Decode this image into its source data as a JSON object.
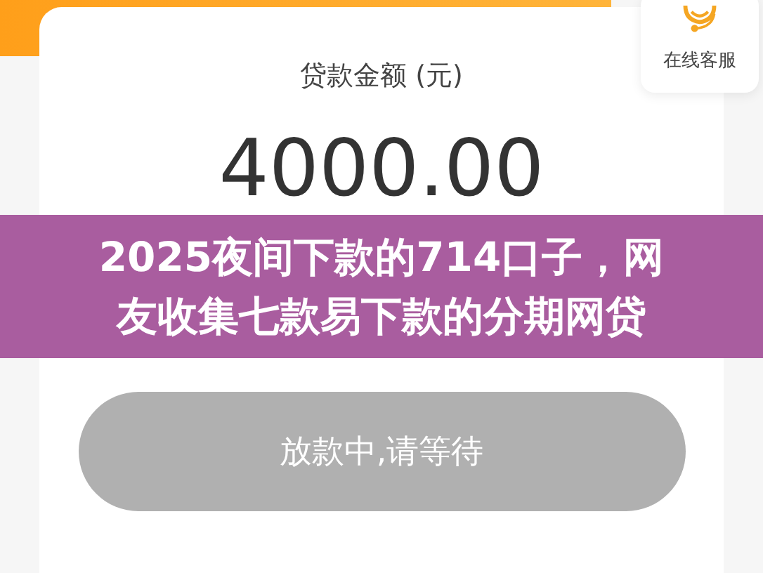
{
  "service": {
    "label": "在线客服"
  },
  "loan": {
    "label": "贷款金额 (元)",
    "amount": "4000.00"
  },
  "submit": {
    "label": "放款中,请等待",
    "disabled": true
  },
  "banner": {
    "lines": [
      "2025夜间下款的714口子，网",
      "友收集七款易下款的分期网贷"
    ]
  }
}
